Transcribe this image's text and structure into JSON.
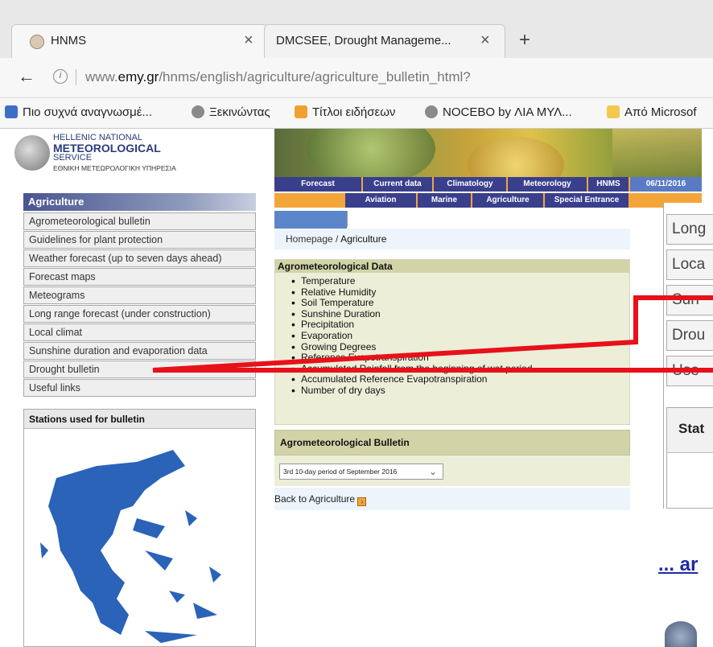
{
  "browser": {
    "tabs": [
      {
        "title": "HNMS"
      },
      {
        "title": "DMCSEE, Drought Manageme..."
      }
    ],
    "url_prefix": "www.",
    "url_domain": "emy.gr",
    "url_path": "/hnms/english/agriculture/agriculture_bulletin_html?",
    "bookmarks": [
      {
        "label": "Πιο συχνά αναγνωσμέ..."
      },
      {
        "label": "Ξεκινώντας"
      },
      {
        "label": "Τίτλοι ειδήσεων"
      },
      {
        "label": "NOCEBO by ΛΙΑ ΜΥΛ..."
      },
      {
        "label": "Από Microsof"
      }
    ]
  },
  "logo": {
    "line1": "HELLENIC NATIONAL",
    "line2": "METEOROLOGICAL",
    "line3": "SERVICE",
    "line4": "ΕΘΝΙΚΗ ΜΕΤΕΩΡΟΛΟΓΙΚΗ ΥΠΗΡΕΣΙΑ"
  },
  "topnav": {
    "row1": [
      "Forecast",
      "Current data",
      "Climatology",
      "Meteorology",
      "HNMS"
    ],
    "date": "06/11/2016",
    "row2": [
      "Aviation",
      "Marine",
      "Agriculture",
      "Special Entrance"
    ]
  },
  "sidebar": {
    "title": "Agriculture",
    "items": [
      {
        "label": "Agrometeorological bulletin"
      },
      {
        "label": "Guidelines for plant protection"
      },
      {
        "label": "Weather forecast (up to seven days ahead)"
      },
      {
        "label": "Forecast maps"
      },
      {
        "label": "Meteograms"
      },
      {
        "label": "Long range forecast (under construction)"
      },
      {
        "label": "Local climat"
      },
      {
        "label": "Sunshine duration and evaporation data"
      },
      {
        "label": "Drought bulletin"
      },
      {
        "label": "Useful links"
      }
    ],
    "stations_title": "Stations used for bulletin"
  },
  "main": {
    "breadcrumb_home": "Homepage",
    "breadcrumb_sep": " / ",
    "breadcrumb_current": "Agriculture",
    "agro_data_title": "Agrometeorological Data",
    "agro_data_items": [
      "Temperature",
      "Relative Humidity",
      "Soil Temperature",
      "Sunshine Duration",
      "Precipitation",
      "Evaporation",
      "Growing Degrees",
      "Reference Evapotranspiration",
      "Accumulated Rainfall from the beginning of wet period",
      "Accumulated Reference Evapotranspiration",
      "Number of dry days"
    ],
    "bulletin_title": "Agrometeorological Bulletin",
    "bulletin_select": "3rd 10-day period of September 2016",
    "back_link": "Back to Agriculture"
  },
  "overlay": {
    "right_boxes": [
      "Long",
      "Loca",
      "Sun",
      "Drou",
      "Use"
    ],
    "right_stat": "Stat",
    "link_text": "... ar",
    "colors": {
      "annotation": "#e8101a",
      "link": "#1f2aa6",
      "nav": "#3a3f8c",
      "orange": "#f4a53a"
    }
  }
}
